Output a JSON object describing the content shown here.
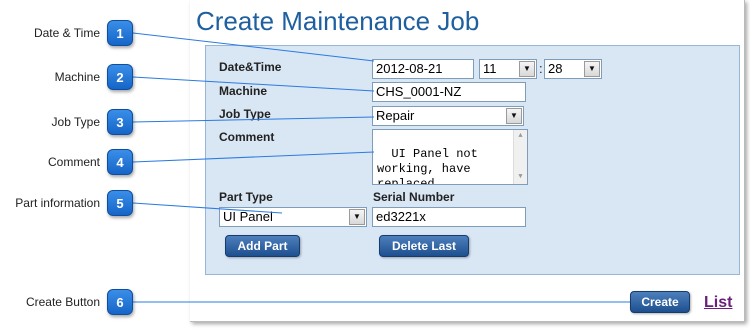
{
  "page": {
    "title": "Create Maintenance Job",
    "list_link": "List",
    "create_button": "Create"
  },
  "callouts": [
    {
      "number": "1",
      "label": "Date & Time"
    },
    {
      "number": "2",
      "label": "Machine"
    },
    {
      "number": "3",
      "label": "Job Type"
    },
    {
      "number": "4",
      "label": "Comment"
    },
    {
      "number": "5",
      "label": "Part information"
    },
    {
      "number": "6",
      "label": "Create Button"
    }
  ],
  "form": {
    "datetime_label": "Date&Time",
    "date_value": "2012-08-21",
    "hour_value": "11",
    "time_separator": ":",
    "minute_value": "28",
    "machine_label": "Machine",
    "machine_value": "CHS_0001-NZ",
    "jobtype_label": "Job Type",
    "jobtype_value": "Repair",
    "comment_label": "Comment",
    "comment_value": "UI Panel not\nworking, have\nreplaced",
    "parttype_label": "Part Type",
    "parttype_value": "UI Panel",
    "serial_label": "Serial Number",
    "serial_value": "ed3221x",
    "add_part_button": "Add Part",
    "delete_last_button": "Delete Last"
  },
  "icons": {
    "dropdown": "chevron-down-icon",
    "scroll_up": "scroll-up-icon",
    "scroll_down": "scroll-down-icon"
  },
  "colors": {
    "title": "#1f5f9f",
    "form_background": "#d9e6f4",
    "button": "#1e4f8e",
    "badge": "#1565c8",
    "link": "#6a1f7a"
  }
}
